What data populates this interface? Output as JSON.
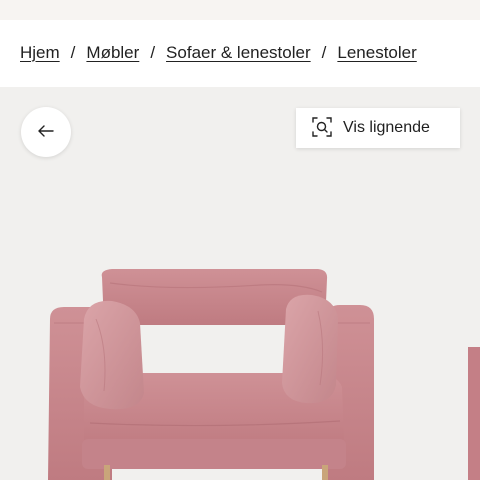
{
  "breadcrumb": {
    "items": [
      {
        "label": "Hjem"
      },
      {
        "label": "Møbler"
      },
      {
        "label": "Sofaer & lenestoler"
      },
      {
        "label": "Lenestoler"
      }
    ],
    "separator": "/"
  },
  "gallery": {
    "back_icon": "arrow-left-icon",
    "similar_button": {
      "label": "Vis lignende",
      "icon": "visual-search-icon"
    },
    "product_color": "#c98a8f"
  }
}
